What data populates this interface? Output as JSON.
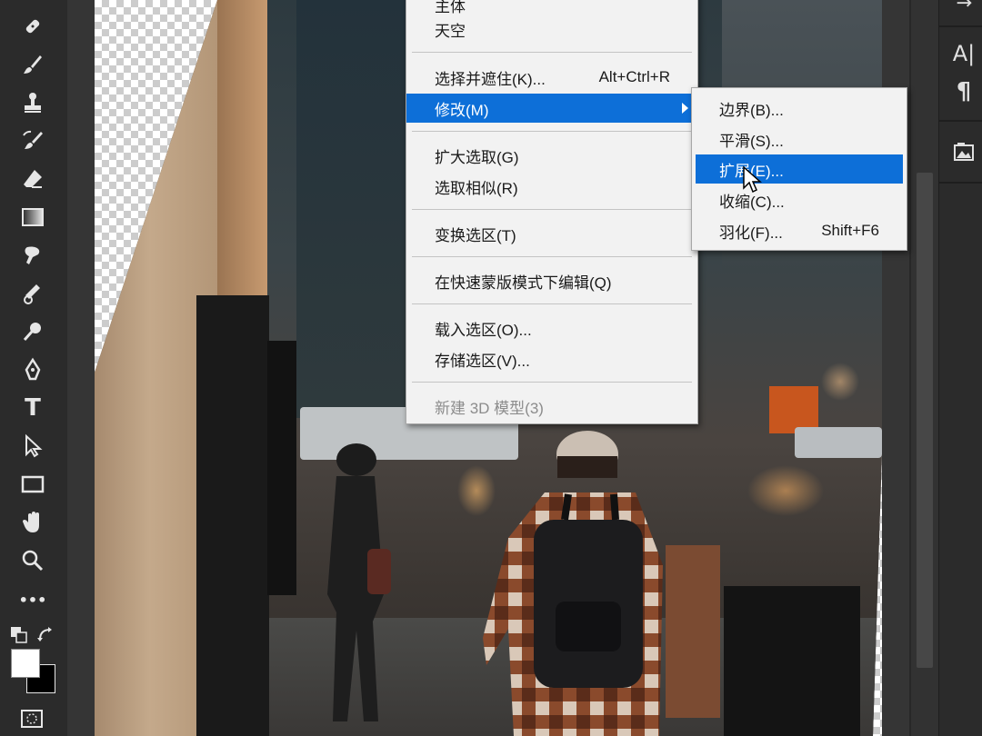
{
  "toolbar": {
    "tools": [
      {
        "name": "spot-healing-brush-icon"
      },
      {
        "name": "brush-icon"
      },
      {
        "name": "clone-stamp-icon"
      },
      {
        "name": "history-brush-icon"
      },
      {
        "name": "eraser-icon"
      },
      {
        "name": "gradient-icon"
      },
      {
        "name": "smudge-icon"
      },
      {
        "name": "dodge-burn-icon"
      },
      {
        "name": "zoom-dodge-icon"
      },
      {
        "name": "pen-icon"
      },
      {
        "name": "type-icon",
        "glyph": "T"
      },
      {
        "name": "path-selection-icon"
      },
      {
        "name": "rectangle-icon"
      },
      {
        "name": "hand-icon"
      },
      {
        "name": "zoom-icon"
      },
      {
        "name": "more-tools-icon",
        "glyph": "•••"
      }
    ],
    "foreground_color": "#ffffff",
    "background_color": "#000000"
  },
  "main_menu": {
    "items": [
      {
        "label": "主体",
        "shortcut": ""
      },
      {
        "label": "天空",
        "shortcut": ""
      },
      {
        "label": "选择并遮住(K)...",
        "shortcut": "Alt+Ctrl+R"
      },
      {
        "label": "修改(M)",
        "shortcut": "",
        "highlighted": true,
        "submenu": true
      },
      {
        "label": "扩大选取(G)",
        "shortcut": ""
      },
      {
        "label": "选取相似(R)",
        "shortcut": ""
      },
      {
        "label": "变换选区(T)",
        "shortcut": ""
      },
      {
        "label": "在快速蒙版模式下编辑(Q)",
        "shortcut": ""
      },
      {
        "label": "载入选区(O)...",
        "shortcut": ""
      },
      {
        "label": "存储选区(V)...",
        "shortcut": ""
      },
      {
        "label": "新建 3D 模型(3)",
        "shortcut": "",
        "disabled": true
      }
    ]
  },
  "submenu": {
    "items": [
      {
        "label": "边界(B)...",
        "shortcut": ""
      },
      {
        "label": "平滑(S)...",
        "shortcut": ""
      },
      {
        "label": "扩展(E)...",
        "shortcut": "",
        "highlighted": true
      },
      {
        "label": "收缩(C)...",
        "shortcut": ""
      },
      {
        "label": "羽化(F)...",
        "shortcut": "Shift+F6"
      }
    ]
  },
  "right_panel": {
    "paragraph_glyph": "¶",
    "character_glyph": "A|"
  },
  "colors": {
    "highlight": "#0d6fd8",
    "menu_bg": "#f2f2f2"
  }
}
